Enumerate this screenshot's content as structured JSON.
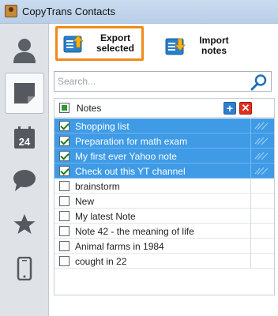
{
  "window": {
    "title": "CopyTrans Contacts"
  },
  "sidebar": {
    "items": [
      {
        "icon": "contacts-person-icon",
        "active": false
      },
      {
        "icon": "notes-icon",
        "active": true
      },
      {
        "icon": "calendar-icon",
        "active": false,
        "calendar_day": "24"
      },
      {
        "icon": "messages-bubble-icon",
        "active": false
      },
      {
        "icon": "star-icon",
        "active": false
      },
      {
        "icon": "phone-icon",
        "active": false
      }
    ]
  },
  "toolbar": {
    "export_label": "Export\nselected",
    "import_label": "Import\nnotes"
  },
  "search": {
    "placeholder": "Search...",
    "value": ""
  },
  "notes": {
    "header_label": "Notes",
    "items": [
      {
        "label": "Shopping list",
        "checked": true,
        "selected": true
      },
      {
        "label": "Preparation for math exam",
        "checked": true,
        "selected": true
      },
      {
        "label": "My first ever Yahoo note",
        "checked": true,
        "selected": true
      },
      {
        "label": "Check out this YT channel",
        "checked": true,
        "selected": true
      },
      {
        "label": "brainstorm",
        "checked": false,
        "selected": false
      },
      {
        "label": "New",
        "checked": false,
        "selected": false
      },
      {
        "label": "My latest Note",
        "checked": false,
        "selected": false
      },
      {
        "label": "Note 42 - the meaning of life",
        "checked": false,
        "selected": false
      },
      {
        "label": "Animal farms in 1984",
        "checked": false,
        "selected": false
      },
      {
        "label": "cought in 22",
        "checked": false,
        "selected": false
      }
    ]
  },
  "colors": {
    "accent_orange": "#f08a1c",
    "selection_blue": "#3f9be6",
    "check_green": "#2c9a2c"
  }
}
